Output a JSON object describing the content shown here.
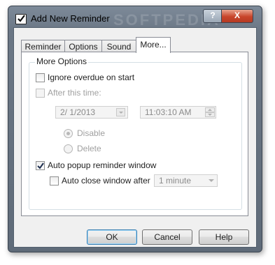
{
  "window": {
    "title": "Add New Reminder",
    "watermark": "SOFTPEDIA",
    "help_button": "?",
    "close_button": "X"
  },
  "tabs": [
    {
      "label": "Reminder",
      "active": false
    },
    {
      "label": "Options",
      "active": false
    },
    {
      "label": "Sound",
      "active": false
    },
    {
      "label": "More...",
      "active": true
    }
  ],
  "more_options": {
    "group_title": "More Options",
    "ignore_overdue": {
      "label": "Ignore overdue on start",
      "checked": false
    },
    "after_this_time": {
      "label": "After this time:",
      "checked": false,
      "enabled": false
    },
    "date_value": "2/ 1/2013",
    "time_value": "11:03:10 AM",
    "radio_disable": {
      "label": "Disable",
      "selected": true
    },
    "radio_delete": {
      "label": "Delete",
      "selected": false
    },
    "auto_popup": {
      "label": "Auto popup reminder window",
      "checked": true
    },
    "auto_close": {
      "label": "Auto close window after",
      "checked": false
    },
    "auto_close_duration": "1 minute"
  },
  "buttons": {
    "ok": "OK",
    "cancel": "Cancel",
    "help": "Help"
  }
}
